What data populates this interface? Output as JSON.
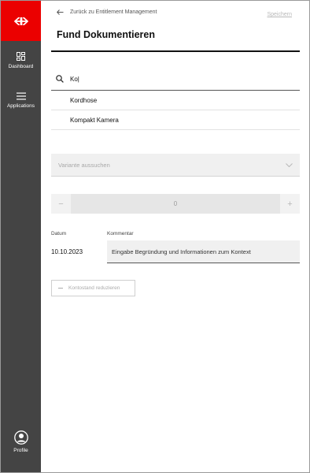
{
  "sidebar": {
    "items": [
      {
        "label": "Dashboard",
        "icon": "dashboard-icon"
      },
      {
        "label": "Applications",
        "icon": "menu-icon"
      }
    ],
    "profile": {
      "label": "Profile",
      "icon": "user-icon"
    },
    "brand_color": "#eb0000",
    "background": "#444444"
  },
  "header": {
    "back_label": "Zurück zu Entitlement Management",
    "save_label": "Speichern",
    "title": "Fund Dokumentieren"
  },
  "search": {
    "value": "Ko|",
    "suggestions": [
      "Kordhose",
      "Kompakt Kamera"
    ]
  },
  "variant": {
    "placeholder": "Variante aussuchen"
  },
  "stepper": {
    "minus": "−",
    "value": "0",
    "plus": "+"
  },
  "fields": {
    "date_label": "Datum",
    "date_value": "10.10.2023",
    "comment_label": "Kommentar",
    "comment_value": "Eingabe Begründung und Informationen zum Kontext"
  },
  "actions": {
    "reduce_label": "Kontostand reduzieren"
  }
}
